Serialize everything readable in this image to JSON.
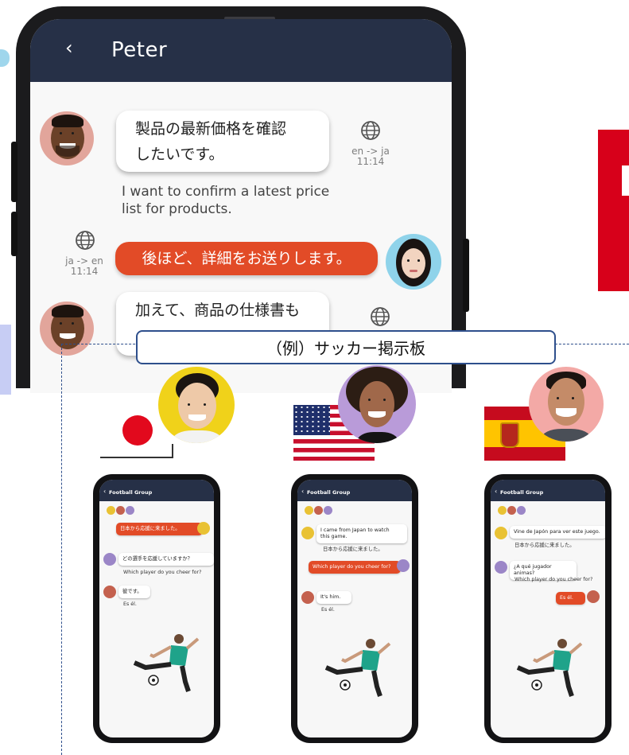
{
  "main_chat": {
    "title": "Peter",
    "back_icon": "chevron-left-icon",
    "header_color": "#263047",
    "accent_color": "#e24b27",
    "messages": [
      {
        "side": "left",
        "text_line1": "製品の最新価格を確認",
        "text_line2": "したいです。",
        "lang": "en -> ja",
        "time": "11:14",
        "translation_line1": "I want to confirm a latest price",
        "translation_line2": "list for products."
      },
      {
        "side": "right",
        "text": "後ほど、詳細をお送りします。",
        "lang": "ja -> en",
        "time": "11:14"
      },
      {
        "side": "left",
        "text_line1": "加えて、商品の仕様書も"
      }
    ]
  },
  "caption": "（例）サッカー掲示板",
  "phones": [
    {
      "country": "jp",
      "group_title": "Football Group",
      "messages": [
        {
          "side": "right",
          "text": "日本から応援に来ました。"
        },
        {
          "side": "left",
          "text": "どの選手を応援していますか？",
          "translation": "Which player do you cheer for?"
        },
        {
          "side": "left",
          "text": "彼です。",
          "translation": "Es él."
        }
      ]
    },
    {
      "country": "us",
      "group_title": "Football Group",
      "messages": [
        {
          "side": "left",
          "text_line1": "I came from Japan to watch",
          "text_line2": "this game.",
          "translation": "日本から応援に来ました。"
        },
        {
          "side": "right",
          "text": "Which player do you cheer for?"
        },
        {
          "side": "left",
          "text": "It's him.",
          "translation": "Es él."
        }
      ]
    },
    {
      "country": "es",
      "group_title": "Football Group",
      "messages": [
        {
          "side": "left",
          "text": "Vine de Japón para ver este juego.",
          "translation": "日本から応援に来ました。"
        },
        {
          "side": "left",
          "text": "¿A qué jugador animas?",
          "translation": "Which player do you cheer for?"
        },
        {
          "side": "right",
          "text": "Es él."
        }
      ]
    }
  ]
}
